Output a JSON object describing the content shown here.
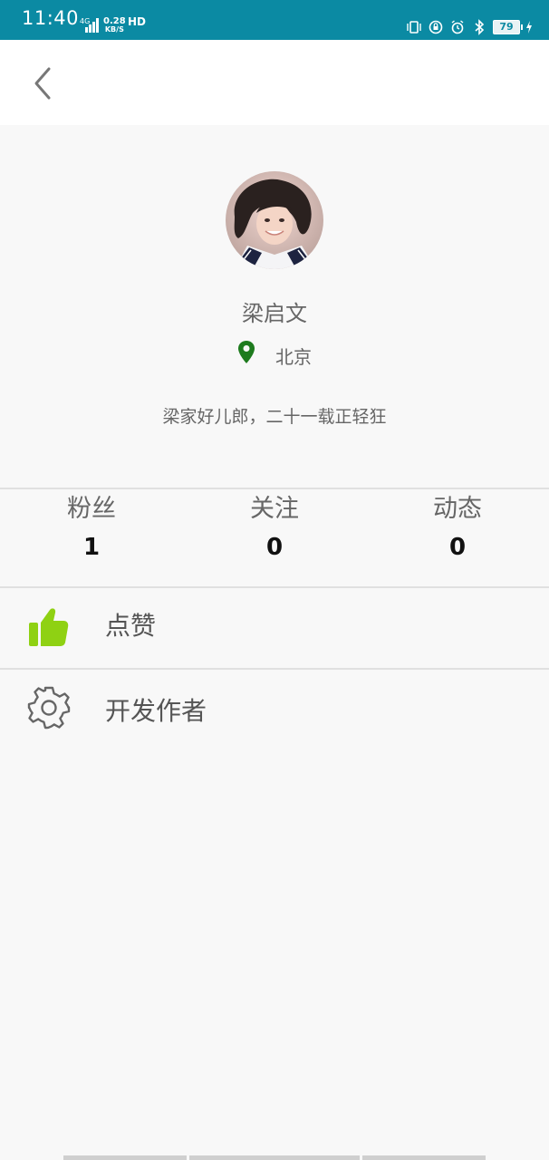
{
  "status_bar": {
    "time": "11:40",
    "network_type": "4G",
    "speed_value": "0.28",
    "speed_unit": "KB/S",
    "hd_label": "HD",
    "battery": "79",
    "bg_color": "#0b8aa3"
  },
  "nav": {
    "back_icon": "chevron-left-icon"
  },
  "profile": {
    "avatar_icon": "avatar-photo",
    "name": "梁启文",
    "location_icon": "location-pin-icon",
    "location_color": "#1e7b1e",
    "location": "北京",
    "bio": "梁家好儿郎，二十一载正轻狂"
  },
  "stats": [
    {
      "label": "粉丝",
      "value": "1"
    },
    {
      "label": "关注",
      "value": "0"
    },
    {
      "label": "动态",
      "value": "0"
    }
  ],
  "menu": [
    {
      "label": "点赞",
      "icon": "thumbs-up-icon",
      "icon_color": "#8fd113"
    },
    {
      "label": "开发作者",
      "icon": "gear-icon",
      "icon_color": "#666666"
    }
  ]
}
